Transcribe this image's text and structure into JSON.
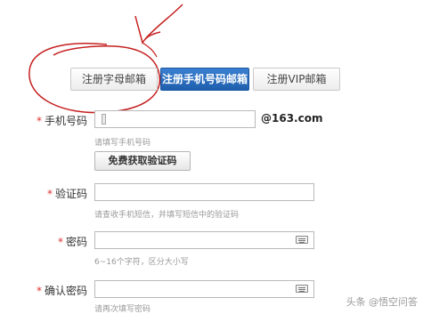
{
  "tabs": [
    {
      "label": "注册字母邮箱",
      "active": false
    },
    {
      "label": "注册手机号码邮箱",
      "active": true
    },
    {
      "label": "注册VIP邮箱",
      "active": false
    }
  ],
  "form": {
    "phone": {
      "label": "手机号码",
      "required_mark": "*",
      "value": "",
      "suffix": "@163.com",
      "hint": "请填写手机号码"
    },
    "get_code_button": "免费获取验证码",
    "code": {
      "label": "验证码",
      "required_mark": "*",
      "value": "",
      "hint": "请查收手机短信，并填写短信中的验证码"
    },
    "password": {
      "label": "密码",
      "required_mark": "*",
      "value": "",
      "hint": "6~16个字符，区分大小写"
    },
    "confirm_password": {
      "label": "确认密码",
      "required_mark": "*",
      "value": "",
      "hint": "请再次填写密码"
    }
  },
  "watermark": "头条 @悟空问答",
  "colors": {
    "active_tab": "#2a6bbd",
    "required_star": "#dd3333",
    "annotation": "#cc2222"
  }
}
